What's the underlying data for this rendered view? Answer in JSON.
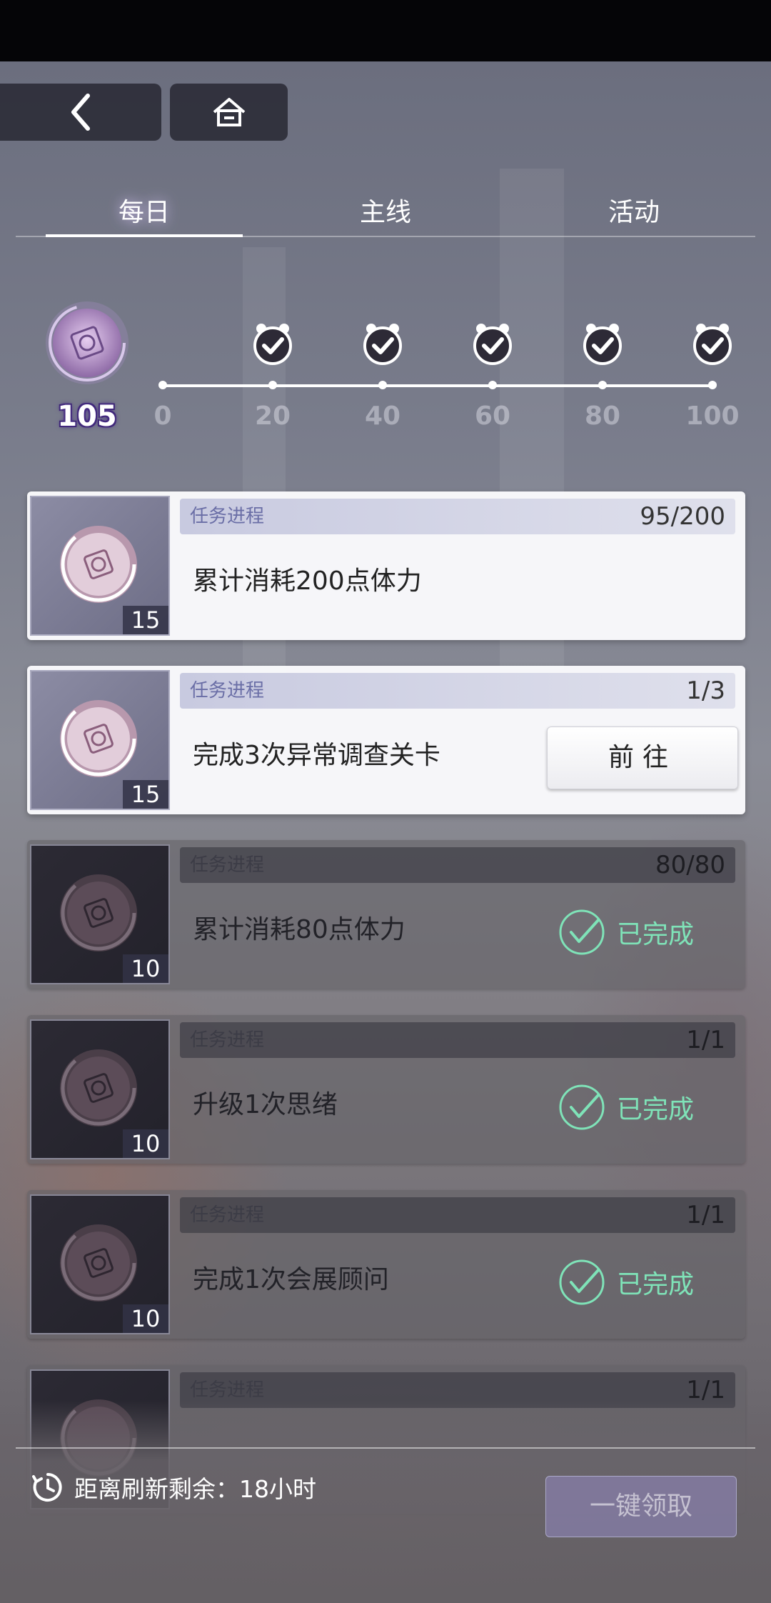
{
  "nav": {
    "back_icon": "chevron-left-icon",
    "home_icon": "home-icon"
  },
  "tabs": [
    {
      "label": "每日",
      "active": true
    },
    {
      "label": "主线",
      "active": false
    },
    {
      "label": "活动",
      "active": false
    }
  ],
  "activity": {
    "points": "105",
    "milestones": [
      "0",
      "20",
      "40",
      "60",
      "80",
      "100"
    ],
    "milestone_icon": "alarm-check-icon"
  },
  "tasks": [
    {
      "progress_label": "任务进程",
      "progress": "95/200",
      "text": "累计消耗200点体力",
      "reward_qty": "15",
      "state": "active",
      "action": ""
    },
    {
      "progress_label": "任务进程",
      "progress": "1/3",
      "text": "完成3次异常调查关卡",
      "reward_qty": "15",
      "state": "active",
      "action": "前往"
    },
    {
      "progress_label": "任务进程",
      "progress": "80/80",
      "text": "累计消耗80点体力",
      "reward_qty": "10",
      "state": "done",
      "action": "已完成"
    },
    {
      "progress_label": "任务进程",
      "progress": "1/1",
      "text": "升级1次思绪",
      "reward_qty": "10",
      "state": "done",
      "action": "已完成"
    },
    {
      "progress_label": "任务进程",
      "progress": "1/1",
      "text": "完成1次会展顾问",
      "reward_qty": "10",
      "state": "done",
      "action": "已完成"
    },
    {
      "progress_label": "任务进程",
      "progress": "1/1",
      "text": "",
      "reward_qty": "",
      "state": "done",
      "action": ""
    }
  ],
  "footer": {
    "refresh_text": "距离刷新剩余：18小时",
    "claim_all_label": "一键领取"
  },
  "colors": {
    "accent_green": "#7fe3b8",
    "accent_purple": "#6a6ea6"
  }
}
